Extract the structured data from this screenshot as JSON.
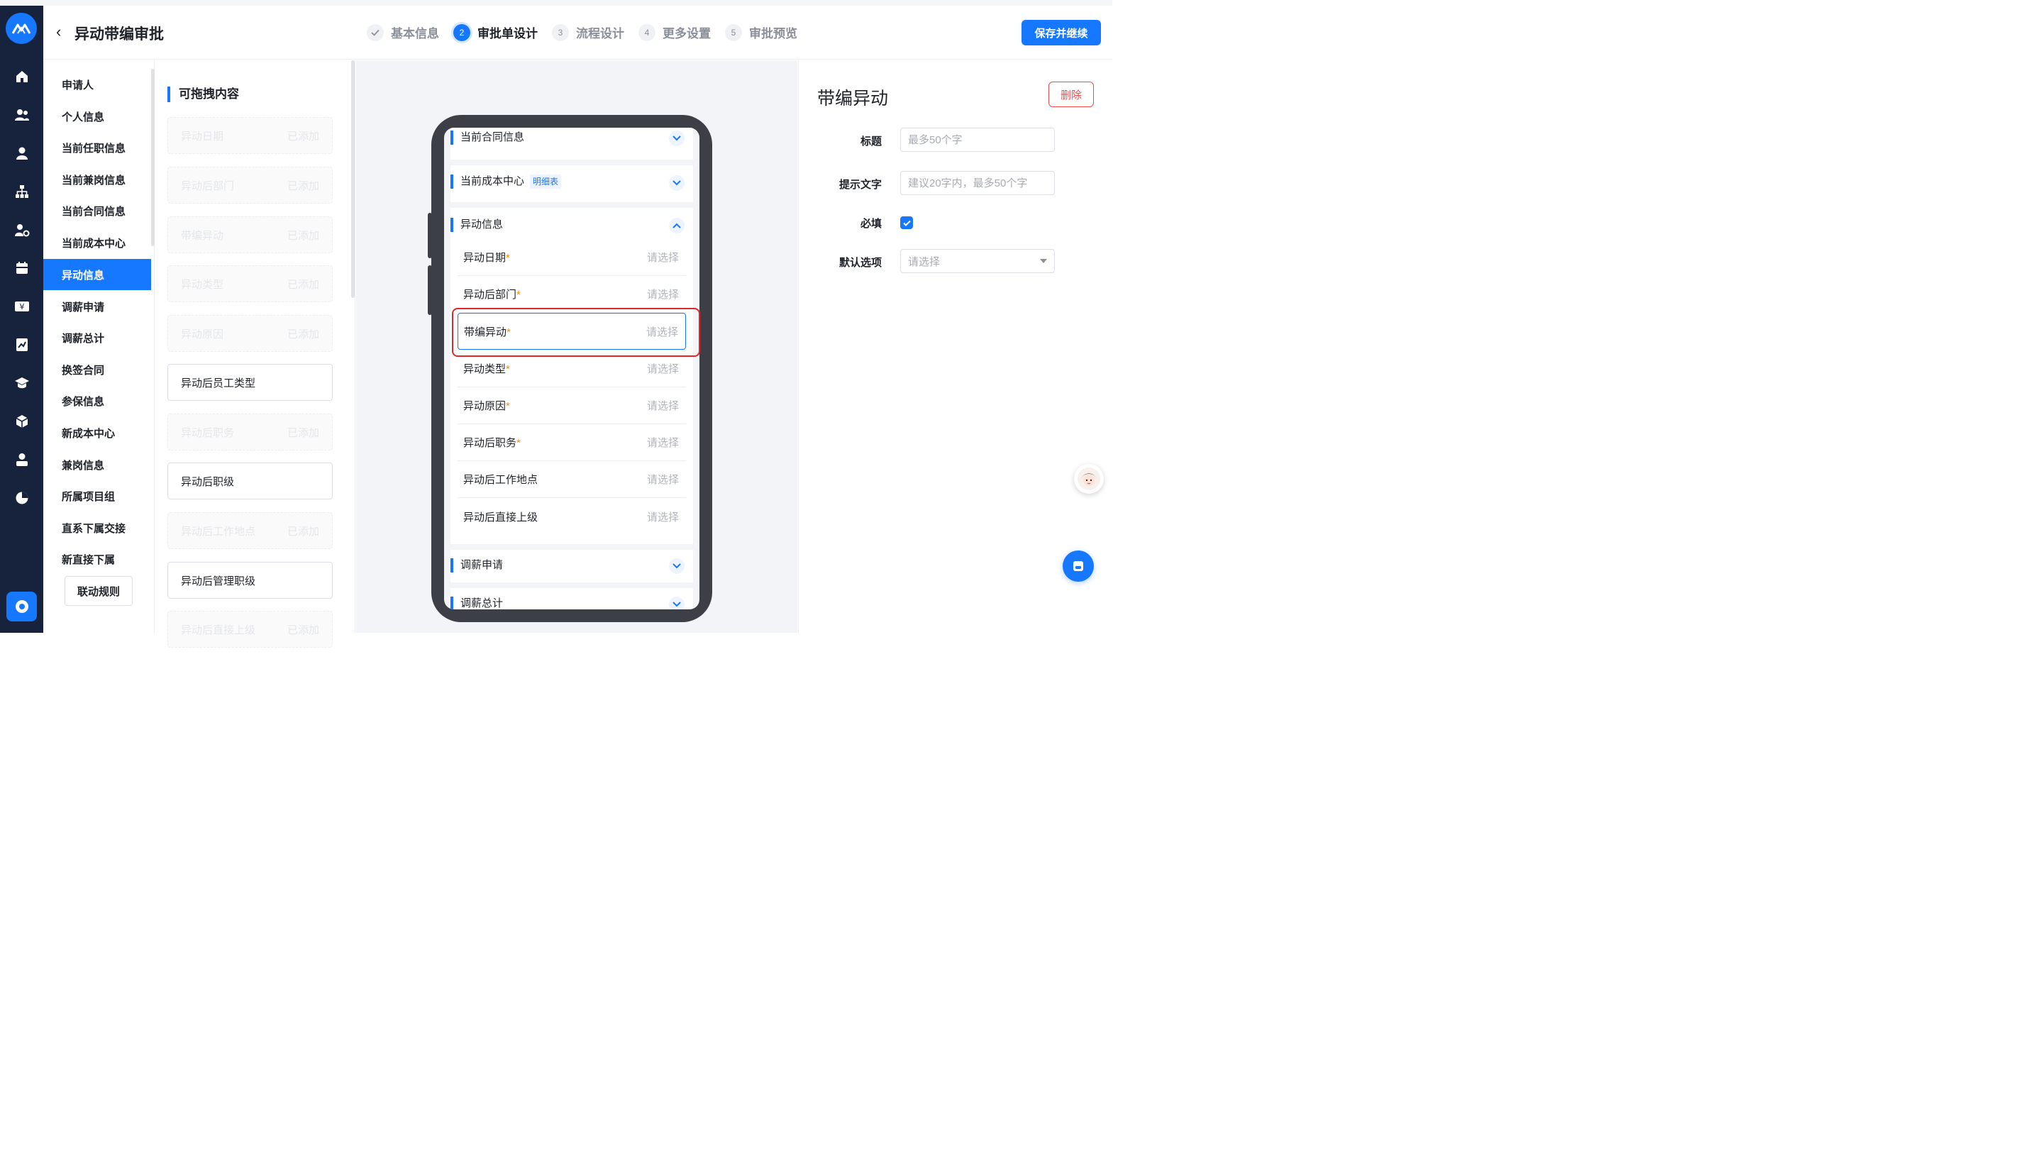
{
  "header": {
    "title": "异动带编审批",
    "save_label": "保存并继续",
    "steps": [
      {
        "num": "",
        "label": "基本信息",
        "state": "done"
      },
      {
        "num": "2",
        "label": "审批单设计",
        "state": "active"
      },
      {
        "num": "3",
        "label": "流程设计",
        "state": "todo"
      },
      {
        "num": "4",
        "label": "更多设置",
        "state": "todo"
      },
      {
        "num": "5",
        "label": "审批预览",
        "state": "todo"
      }
    ]
  },
  "rail": {
    "icons": [
      "home-icon",
      "group-icon",
      "user-icon",
      "org-chart-icon",
      "user-settings-icon",
      "calendar-icon",
      "salary-icon",
      "report-icon",
      "training-icon",
      "cube-icon",
      "person-icon",
      "pie-chart-icon"
    ],
    "accent": "#1677ff",
    "background": "#17233d"
  },
  "groups": {
    "items": [
      "申请人",
      "个人信息",
      "当前任职信息",
      "当前兼岗信息",
      "当前合同信息",
      "当前成本中心",
      "异动信息",
      "调薪申请",
      "调薪总计",
      "换签合同",
      "参保信息",
      "新成本中心",
      "兼岗信息",
      "所属项目组",
      "直系下属交接",
      "新直接下属"
    ],
    "active_index": 6,
    "rule_button": "联动规则"
  },
  "drag": {
    "title": "可拖拽内容",
    "added_label": "已添加",
    "cards": [
      {
        "label": "异动日期",
        "added": true
      },
      {
        "label": "异动后部门",
        "added": true
      },
      {
        "label": "带编异动",
        "added": true
      },
      {
        "label": "异动类型",
        "added": true
      },
      {
        "label": "异动原因",
        "added": true
      },
      {
        "label": "异动后员工类型",
        "added": false
      },
      {
        "label": "异动后职务",
        "added": true
      },
      {
        "label": "异动后职级",
        "added": false
      },
      {
        "label": "异动后工作地点",
        "added": true
      },
      {
        "label": "异动后管理职级",
        "added": false
      },
      {
        "label": "异动后直接上级",
        "added": true
      }
    ]
  },
  "phone": {
    "sections": {
      "contract": "当前合同信息",
      "cost_center": "当前成本中心",
      "cost_center_tag": "明细表",
      "change_info": "异动信息",
      "salary_adjust": "调薪申请",
      "salary_total": "调薪总计"
    },
    "placeholder": "请选择",
    "fields": [
      {
        "label": "异动日期",
        "required": "*"
      },
      {
        "label": "异动后部门",
        "required": "*"
      },
      {
        "label": "带编异动",
        "required": "*",
        "selected": true
      },
      {
        "label": "异动类型",
        "required": "*"
      },
      {
        "label": "异动原因",
        "required": "*"
      },
      {
        "label": "异动后职务",
        "required": "*"
      },
      {
        "label": "异动后工作地点",
        "required": ""
      },
      {
        "label": "异动后直接上级",
        "required": ""
      }
    ]
  },
  "props": {
    "title": "带编异动",
    "delete_label": "删除",
    "title_label": "标题",
    "title_placeholder": "最多50个字",
    "hint_label": "提示文字",
    "hint_placeholder": "建议20字内，最多50个字",
    "required_label": "必填",
    "required_checked": true,
    "default_label": "默认选项",
    "default_placeholder": "请选择"
  }
}
